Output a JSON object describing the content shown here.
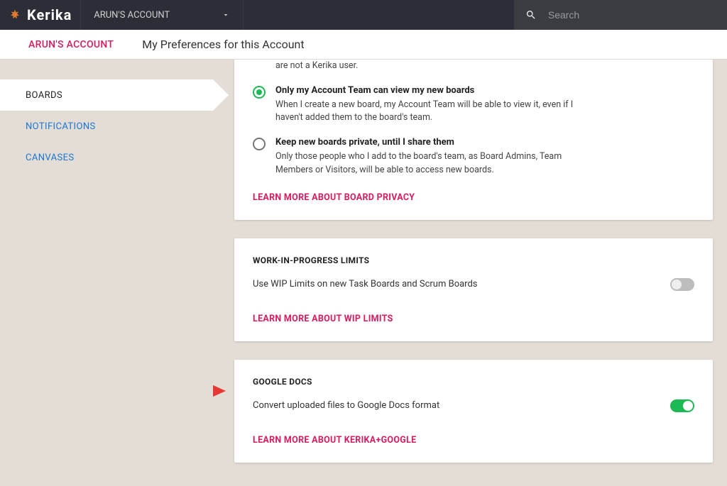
{
  "topbar": {
    "brand": "Kerika",
    "account_label": "ARUN'S ACCOUNT",
    "search_placeholder": "Search"
  },
  "subheader": {
    "account_link": "ARUN'S ACCOUNT",
    "page_title": "My Preferences for this Account"
  },
  "sidebar": {
    "items": [
      {
        "label": "BOARDS",
        "active": true
      },
      {
        "label": "NOTIFICATIONS",
        "active": false
      },
      {
        "label": "CANVASES",
        "active": false
      }
    ]
  },
  "privacy": {
    "orphan_desc": "are not a Kerika user.",
    "option_team": {
      "title": "Only my Account Team can view my new boards",
      "desc": "When I create a new board, my Account Team will be able to view it, even if I haven't added them to the board's team."
    },
    "option_private": {
      "title": "Keep new boards private, until I share them",
      "desc": "Only those people who I add to the board's team, as Board Admins, Team Members or Visitors, will be able to access new boards."
    },
    "learn": "LEARN MORE ABOUT BOARD PRIVACY"
  },
  "wip": {
    "title": "WORK-IN-PROGRESS LIMITS",
    "label": "Use WIP Limits on new Task Boards and Scrum Boards",
    "learn": "LEARN MORE ABOUT WIP LIMITS"
  },
  "gdocs": {
    "title": "GOOGLE DOCS",
    "label": "Convert uploaded files to Google Docs format",
    "learn": "LEARN MORE ABOUT KERIKA+GOOGLE"
  }
}
